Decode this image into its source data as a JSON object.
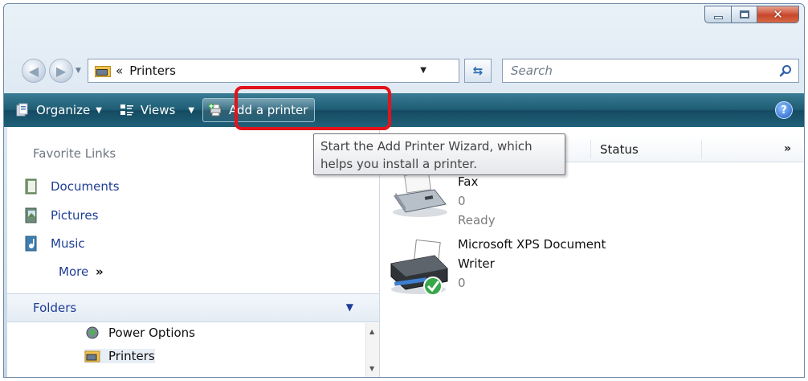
{
  "window": {
    "caption_buttons": [
      "minimize",
      "maximize",
      "close"
    ]
  },
  "address_bar": {
    "prefix": "«",
    "location": "Printers"
  },
  "search": {
    "placeholder": "Search"
  },
  "toolbar": {
    "organize_label": "Organize",
    "views_label": "Views",
    "add_printer_label": "Add a printer",
    "help_label": "?"
  },
  "tooltip": {
    "line1": "Start the Add Printer Wizard, which",
    "line2": "helps you install a printer."
  },
  "left_pane": {
    "favorite_links_header": "Favorite Links",
    "favorite_links": [
      {
        "label": "Documents",
        "icon": "documents-icon"
      },
      {
        "label": "Pictures",
        "icon": "pictures-icon"
      },
      {
        "label": "Music",
        "icon": "music-icon"
      }
    ],
    "more_label": "More",
    "more_chevron": "»",
    "folders_header": "Folders",
    "folder_tree": [
      {
        "label": "Power Options",
        "icon": "power-options-icon"
      },
      {
        "label": "Printers",
        "icon": "printers-folder-icon",
        "selected": true
      }
    ]
  },
  "columns": {
    "status": "Status",
    "overflow": "»"
  },
  "printers": [
    {
      "name": "Fax",
      "jobs": "0",
      "status": "Ready",
      "icon": "fax-icon"
    },
    {
      "name_line1": "Microsoft XPS Document",
      "name_line2": "Writer",
      "jobs": "0",
      "icon": "xps-printer-icon",
      "default": true
    }
  ],
  "colors": {
    "toolbar": "#1d5b73",
    "highlight": "#e3131a",
    "link": "#1e3e95"
  }
}
